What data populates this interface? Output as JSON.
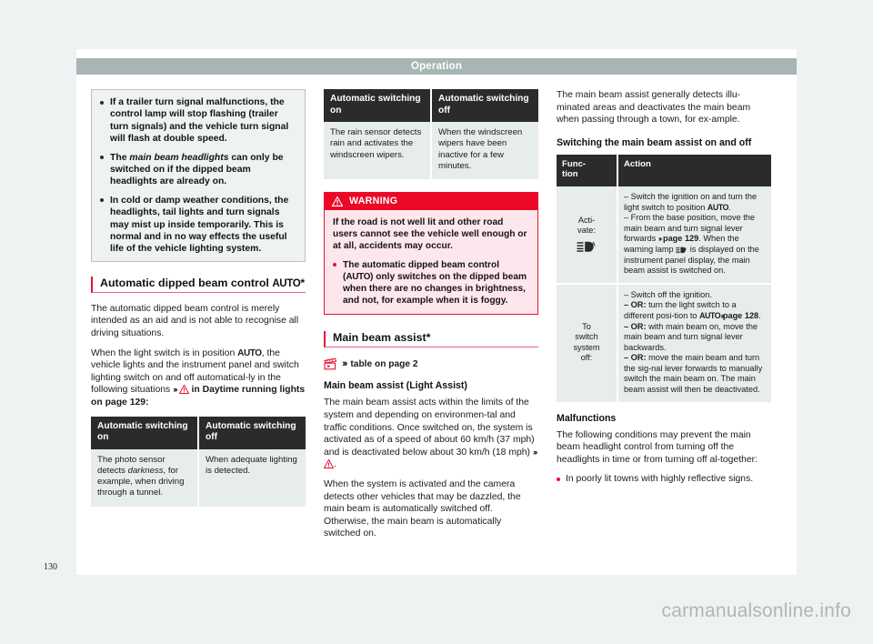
{
  "header": {
    "title": "Operation"
  },
  "page_number": "130",
  "watermark": "carmanualsonline.info",
  "col1": {
    "notebox": {
      "bullets": [
        "If a trailer turn signal malfunctions, the control lamp will stop flashing (trailer turn signals) and the vehicle turn signal will flash at double speed.",
        "The main beam headlights can only be switched on if the dipped beam headlights are already on.",
        "In cold or damp weather conditions, the headlights, tail lights and turn signals may mist up inside temporarily. This is normal and in no way effects the useful life of the vehicle lighting system."
      ],
      "bullet2_pre": "The ",
      "bullet2_italic": "main beam headlights",
      "bullet2_post": " can only be switched on if the dipped beam headlights are already on."
    },
    "heading": "Automatic dipped beam control AUTO*",
    "heading_text": "Automatic dipped beam control ",
    "heading_auto": "AUTO",
    "heading_star": "*",
    "paragraphs": [
      "The automatic dipped beam control is merely intended as an aid and is not able to recognise all driving situations."
    ],
    "para2_a": "When the light switch is in position ",
    "para2_auto": "AUTO",
    "para2_b": ", the vehicle lights and the instrument panel and switch lighting switch on and off automatical-ly in the following situations ",
    "para2_c": " in Daytime running lights on page 129:",
    "table": {
      "headers": [
        "Automatic switching on",
        "Automatic switching off"
      ],
      "row": {
        "on_pre": "The photo sensor detects ",
        "on_italic": "darkness",
        "on_post": ", for example, when driving through a tunnel.",
        "off": "When adequate lighting is detected."
      }
    }
  },
  "col2": {
    "table": {
      "headers": [
        "Automatic switching on",
        "Automatic switching off"
      ],
      "row": {
        "on": "The rain sensor detects rain and activates the windscreen wipers.",
        "off": "When the windscreen wipers have been inactive for a few minutes."
      }
    },
    "warning": {
      "label": "WARNING",
      "body": "If the road is not well lit and other road users cannot see the vehicle well enough or at all, accidents may occur.",
      "bullet_a": "The automatic dipped beam control (",
      "bullet_auto": "AUTO",
      "bullet_b": ") only switches on the dipped beam when there are no changes in brightness, and not, for example when it is foggy."
    },
    "heading": "Main beam assist*",
    "reference": "table on page 2",
    "sub_heading": "Main beam assist (Light Assist)",
    "para1_a": "The main beam assist acts within the limits of the system and depending on environmen-tal and traffic conditions. Once switched on, the system is activated as of a speed of about 60 km/h (37 mph) and is deactivated below about 30 km/h (18 mph) ",
    "para1_b": ".",
    "para2": "When the system is activated and the camera detects other vehicles that may be dazzled, the main beam is automatically switched off. Otherwise, the main beam is automatically switched on."
  },
  "col3": {
    "para1": "The main beam assist generally detects illu-minated areas and deactivates the main beam when passing through a town, for ex-ample.",
    "sub_heading": "Switching the main beam assist on and off",
    "table": {
      "headers": [
        "Func- tion",
        "Action"
      ],
      "header_function": "Func-\ntion",
      "header_action": "Action",
      "rows": [
        {
          "function": "Acti- vate:",
          "function_line1": "Acti-",
          "function_line2": "vate:",
          "icon": "main-beam-assist-symbol",
          "action_1": "– Switch the ignition on and turn the light switch to position ",
          "action_1_auto": "AUTO",
          "action_1_end": ".",
          "action_2": "– From the base position, move the main beam and turn signal lever forwards ",
          "action_2_page": "page 129",
          "action_2_b": ". When the warning lamp ",
          "action_2_c": " is displayed on the instrument panel display, the main beam assist is switched on."
        },
        {
          "function_line1": "To",
          "function_line2": "switch",
          "function_line3": "system",
          "function_line4": "off:",
          "action_l1": "– Switch off the ignition.",
          "action_l2_or": "– OR:",
          "action_l2": " turn the light switch to a different posi-tion to ",
          "action_l2_auto": "AUTO",
          "action_l2_page": "page 128",
          "action_l2_end": ".",
          "action_l3_or": "– OR:",
          "action_l3": " with main beam on, move the main beam and turn signal lever backwards.",
          "action_l4_or": "– OR:",
          "action_l4": " move the main beam and turn the sig-nal lever forwards to manually switch the main beam on. The main beam assist will then be deactivated."
        }
      ]
    },
    "malfunctions_heading": "Malfunctions",
    "malfunctions_para": "The following conditions may prevent the main beam headlight control from turning off the headlights in time or from turning off al-together:",
    "malfunctions_bullet": "In poorly lit towns with highly reflective signs."
  },
  "colors": {
    "accent_red": "#e8112d",
    "warning_red": "#ec0928",
    "warning_bg": "#fde7ec",
    "header_bar": "#a8b5b5",
    "table_header": "#2b2b2b",
    "table_cell": "#e7ecec",
    "note_bg": "#eef2f2",
    "page_bg": "#eef2f2"
  }
}
